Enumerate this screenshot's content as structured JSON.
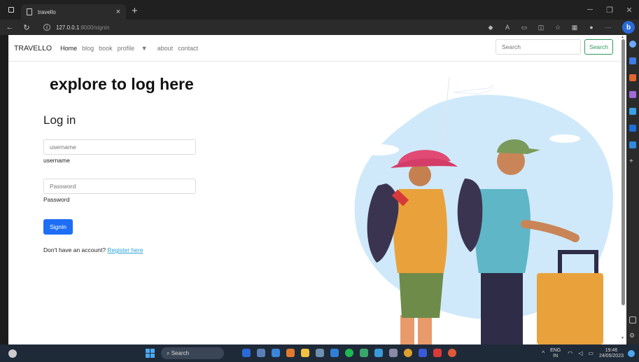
{
  "browser": {
    "tab_title": "travello",
    "tab_close": "×",
    "new_tab": "+",
    "url_host": "127.0.0.1",
    "url_path": ":8000/signin",
    "more": "···"
  },
  "navbar": {
    "brand": "TRAVELLO",
    "links": [
      "Home",
      "blog",
      "book",
      "profile",
      "about",
      "contact"
    ],
    "search_placeholder": "Search",
    "search_button": "Search"
  },
  "hero": {
    "title": "explore to log here"
  },
  "login": {
    "heading": "Log in",
    "username_placeholder": "username",
    "username_label": "username",
    "password_placeholder": "Password",
    "password_label": "Password",
    "submit": "SignIn",
    "register_prompt": "Don't have an account?",
    "register_link": "Register here"
  },
  "taskbar": {
    "search": "Search",
    "lang_top": "ENG",
    "lang_bottom": "IN",
    "time": "19:46",
    "date": "24/05/2023"
  },
  "colors": {
    "signin_button": "#1d6ef5",
    "search_button": "#2f9a5e",
    "link": "#2aa4d6",
    "bubble": "#cfe9fa"
  }
}
